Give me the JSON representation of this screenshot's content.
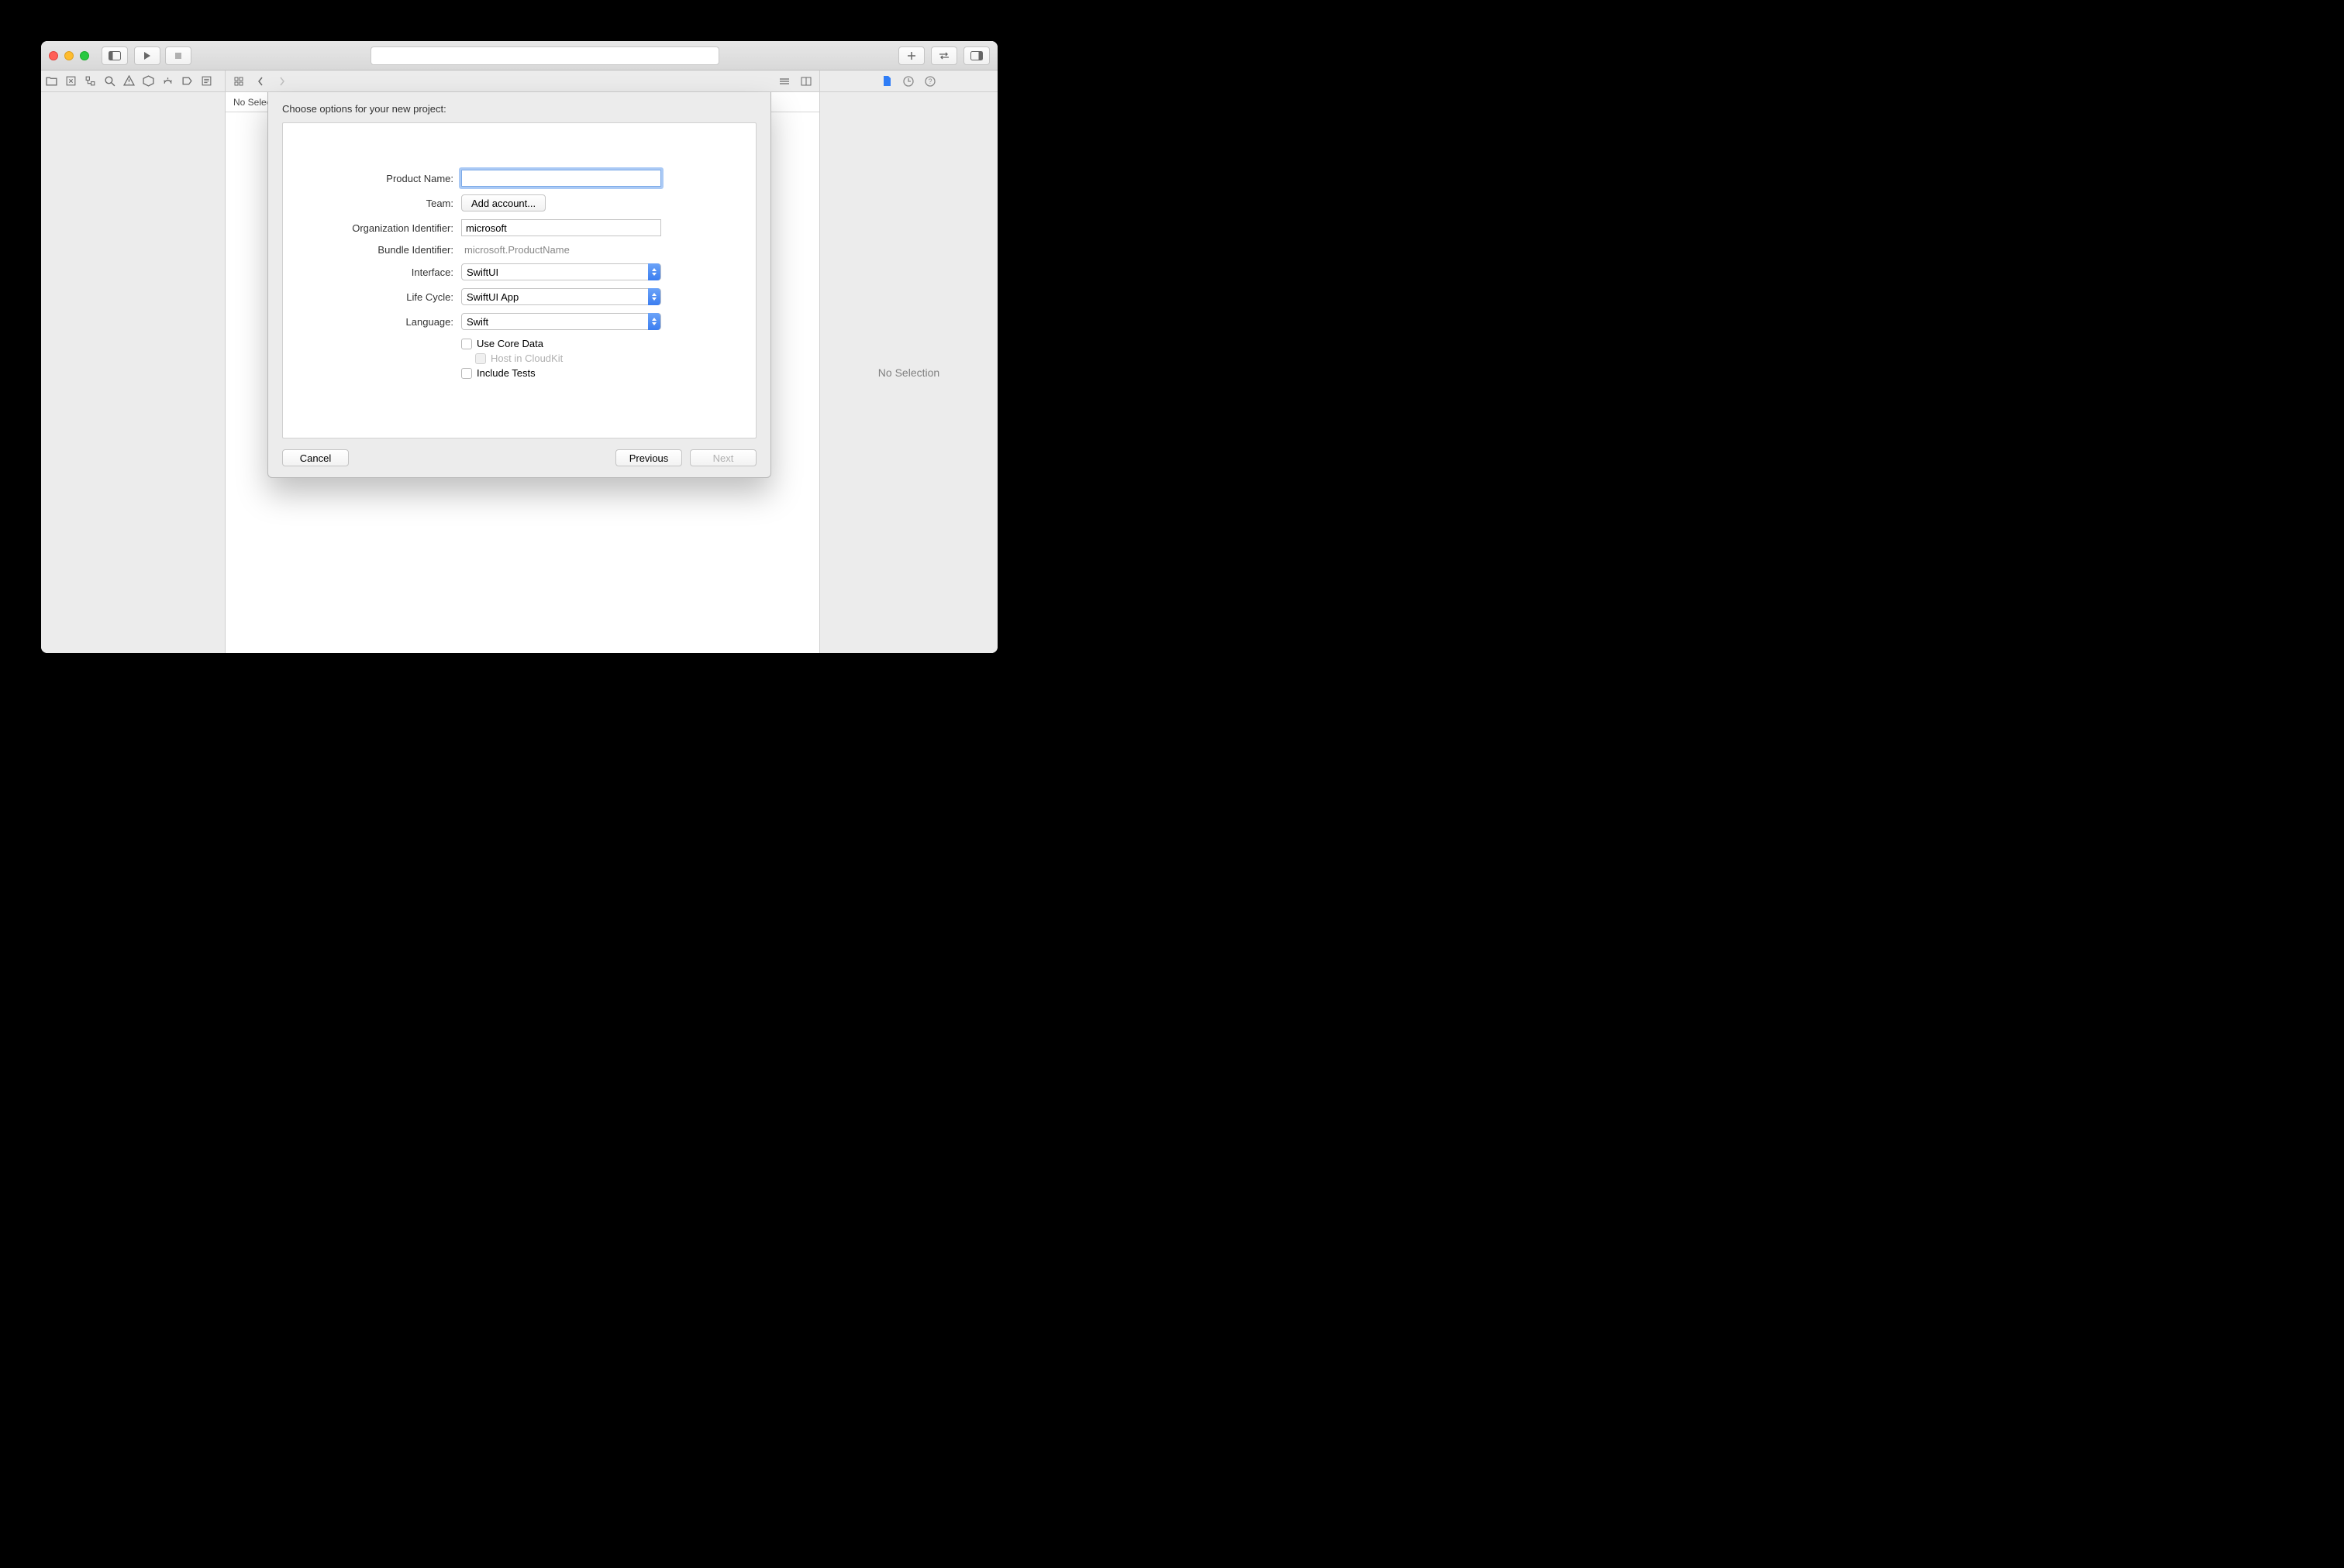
{
  "inspector": {
    "no_selection": "No Selection"
  },
  "editor": {
    "no_selection": "No Selection"
  },
  "sheet": {
    "title": "Choose options for your new project:",
    "labels": {
      "product_name": "Product Name:",
      "team": "Team:",
      "org_identifier": "Organization Identifier:",
      "bundle_identifier": "Bundle Identifier:",
      "interface": "Interface:",
      "life_cycle": "Life Cycle:",
      "language": "Language:"
    },
    "values": {
      "product_name": "",
      "team_button": "Add account...",
      "org_identifier": "microsoft",
      "bundle_identifier": "microsoft.ProductName",
      "interface": "SwiftUI",
      "life_cycle": "SwiftUI App",
      "language": "Swift"
    },
    "checkboxes": {
      "use_core_data": "Use Core Data",
      "host_cloudkit": "Host in CloudKit",
      "include_tests": "Include Tests"
    },
    "buttons": {
      "cancel": "Cancel",
      "previous": "Previous",
      "next": "Next"
    }
  }
}
